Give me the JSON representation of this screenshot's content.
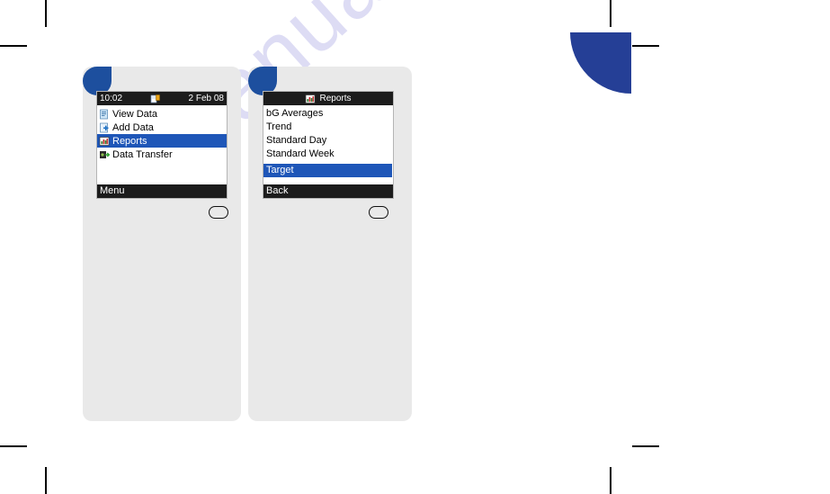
{
  "watermark": {
    "text": "manualshive.com"
  },
  "colors": {
    "selection_blue": "#1e56b8",
    "bar_black": "#1c1c1c",
    "panel_gray": "#e9e9e9",
    "decor_blue": "#1d4f9e",
    "decor_blue_large": "#253f96",
    "watermark_purple": "#c9c7ee"
  },
  "screens": [
    {
      "id": "main-menu",
      "statusbar": {
        "time": "10:02",
        "date": "2 Feb 08",
        "icon": "battery-icon"
      },
      "items": [
        {
          "label": "View Data",
          "icon": "view-data-icon",
          "selected": false
        },
        {
          "label": "Add Data",
          "icon": "add-data-icon",
          "selected": false
        },
        {
          "label": "Reports",
          "icon": "reports-chart-icon",
          "selected": true
        },
        {
          "label": "Data Transfer",
          "icon": "data-transfer-icon",
          "selected": false
        }
      ],
      "softkey": {
        "label": "Menu"
      },
      "button": {
        "name": "ok-button"
      }
    },
    {
      "id": "reports-menu",
      "titlebar": {
        "title": "Reports",
        "icon": "reports-chart-icon"
      },
      "items": [
        {
          "label": "bG Averages",
          "selected": false
        },
        {
          "label": "Trend",
          "selected": false
        },
        {
          "label": "Standard Day",
          "selected": false
        },
        {
          "label": "Standard Week",
          "selected": false
        },
        {
          "label": "Target",
          "selected": true
        }
      ],
      "softkey": {
        "label": "Back"
      },
      "button": {
        "name": "ok-button"
      }
    }
  ]
}
